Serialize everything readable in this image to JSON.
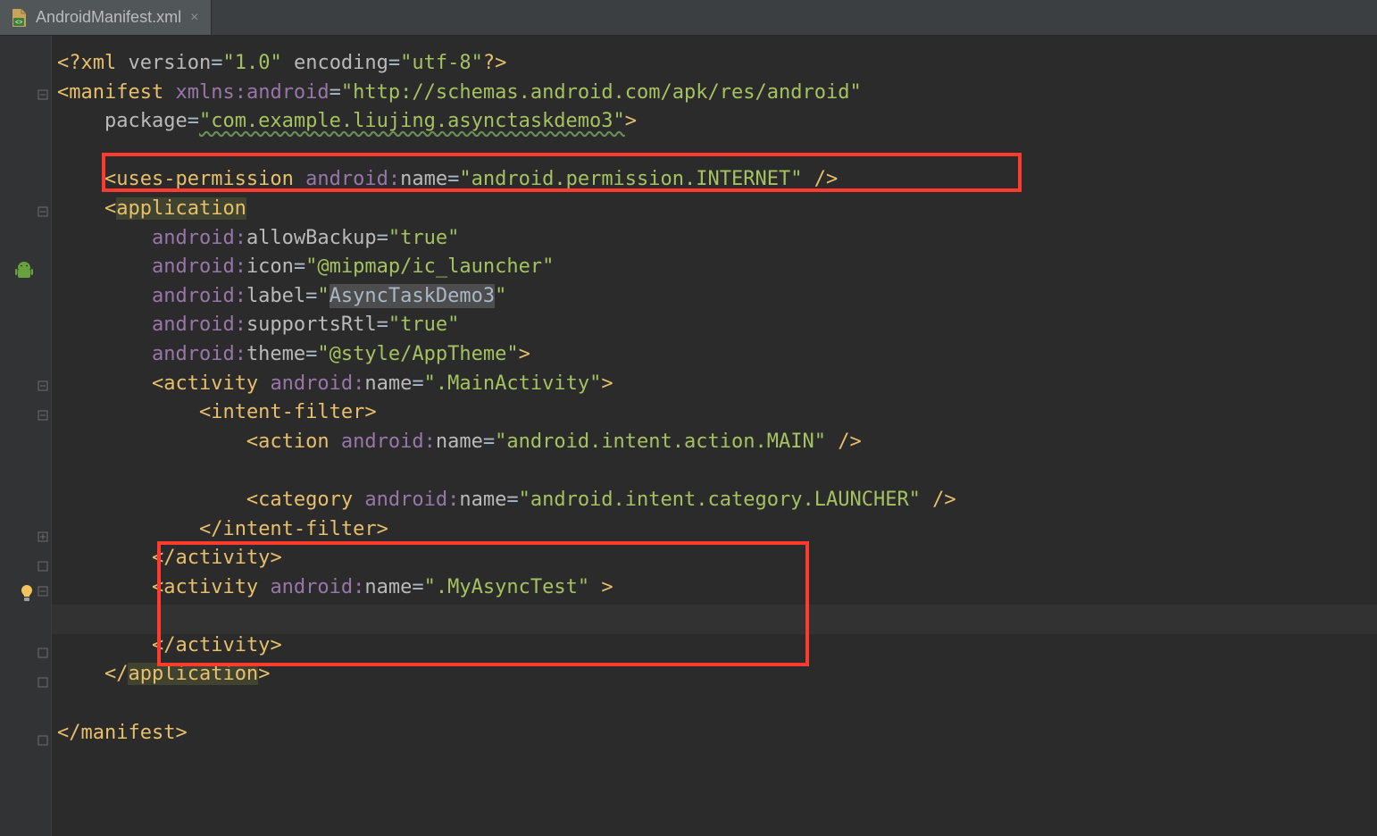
{
  "tab": {
    "filename": "AndroidManifest.xml",
    "close_glyph": "×"
  },
  "code": {
    "xml_decl_open": "<?",
    "xml": "xml",
    "version_key": "version",
    "version_val": "\"1.0\"",
    "encoding_key": "encoding",
    "encoding_val": "\"utf-8\"",
    "xml_decl_close": "?>",
    "manifest": "manifest",
    "xmlns_prefix": "xmlns:",
    "android_ns": "android",
    "xmlns_val": "\"http://schemas.android.com/apk/res/android\"",
    "package_key": "package",
    "package_val": "\"com.example.liujing.asynctaskdemo3\"",
    "uses_permission": "uses-permission",
    "android_name": "name",
    "perm_val": "\"android.permission.INTERNET\"",
    "application": "application",
    "allowBackup": "allowBackup",
    "true_val": "\"true\"",
    "icon": "icon",
    "icon_val": "\"@mipmap/ic_launcher\"",
    "label": "label",
    "label_val_open": "\"",
    "label_val_text": "AsyncTaskDemo3",
    "label_val_close": "\"",
    "supportsRtl": "supportsRtl",
    "theme": "theme",
    "theme_val": "\"@style/AppTheme\"",
    "activity": "activity",
    "main_activity_val": "\".MainActivity\"",
    "intent_filter": "intent-filter",
    "action": "action",
    "action_val": "\"android.intent.action.MAIN\"",
    "category": "category",
    "category_val": "\"android.intent.category.LAUNCHER\"",
    "my_async_val": "\".MyAsyncTest\"",
    "lt": "<",
    "gt": ">",
    "lt_slash": "</",
    "slash_gt": " />",
    "eq": "=",
    "ns_sep": ":"
  }
}
